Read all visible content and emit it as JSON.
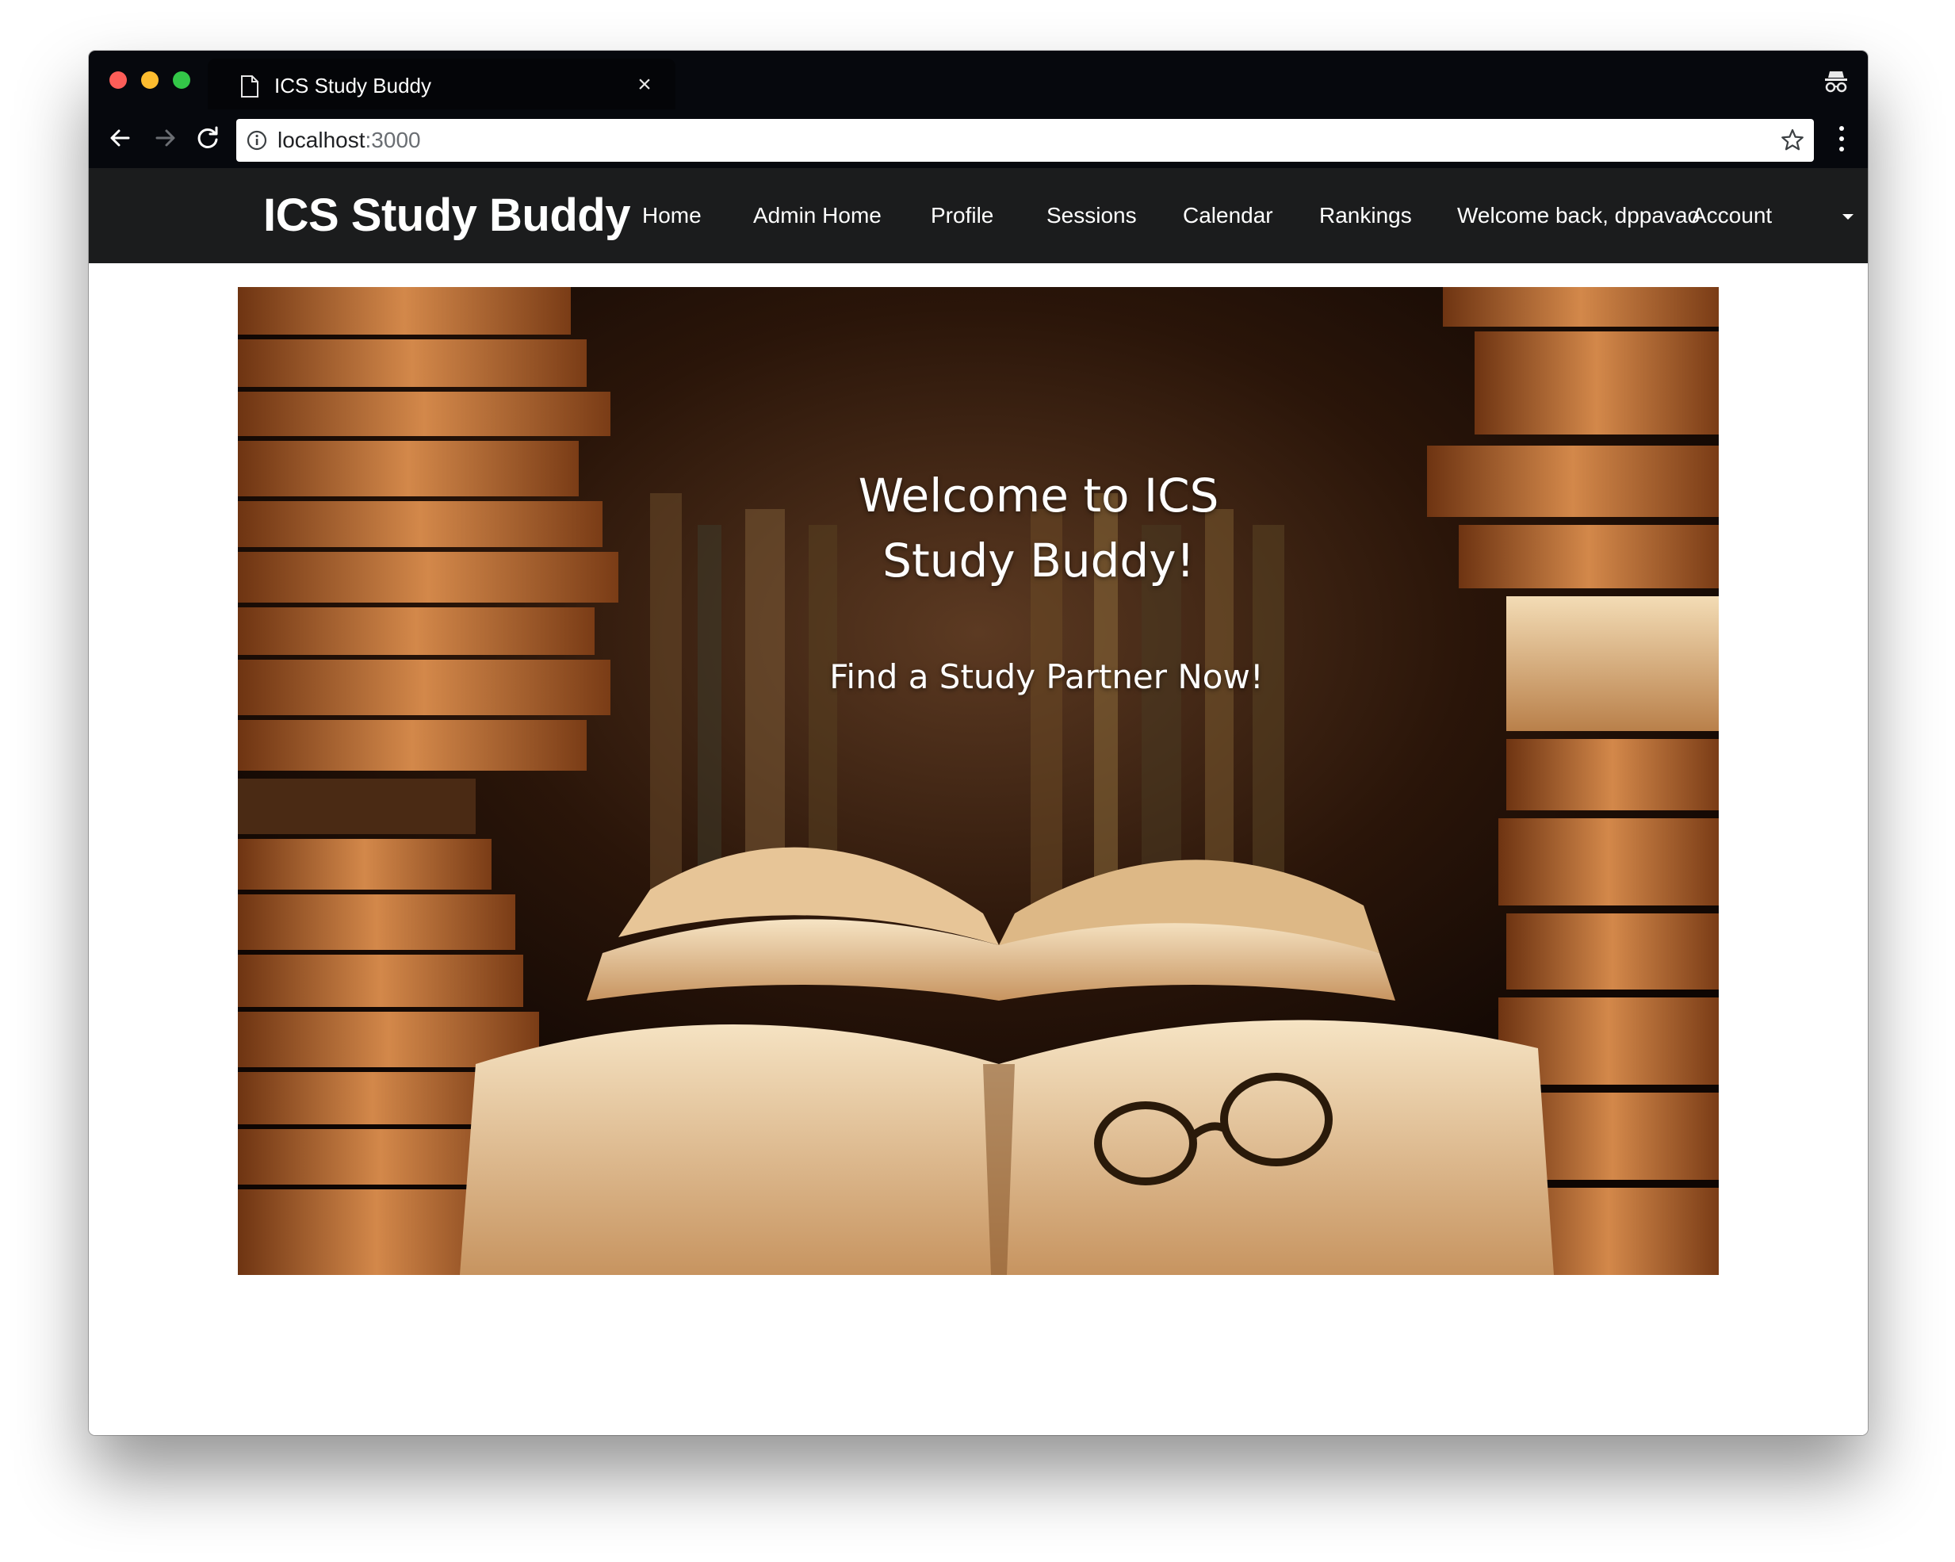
{
  "browser": {
    "tab_title": "ICS Study Buddy",
    "tab_close": "×",
    "url_host": "localhost",
    "url_port": ":3000"
  },
  "navbar": {
    "brand": "ICS Study Buddy",
    "items": [
      {
        "label": "Home"
      },
      {
        "label": "Admin Home"
      },
      {
        "label": "Profile"
      },
      {
        "label": "Sessions"
      },
      {
        "label": "Calendar"
      },
      {
        "label": "Rankings"
      },
      {
        "label": "Welcome back, dppavao"
      },
      {
        "label": "Account"
      }
    ]
  },
  "hero": {
    "title_line1": "Welcome to ICS",
    "title_line2": "Study Buddy!",
    "subtitle": "Find a Study Partner Now!"
  },
  "colors": {
    "navbar_bg": "#1b1c1d",
    "chrome_bg": "#06080d",
    "hero_accent": "#c9773a"
  }
}
